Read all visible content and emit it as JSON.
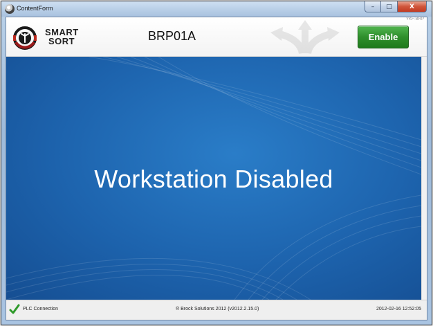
{
  "window": {
    "title": "ContentForm",
    "controls": {
      "minimize": "–",
      "maximize": "□",
      "close": "X"
    }
  },
  "header": {
    "corner_tag": "YKF-BRP",
    "logo_line1": "SMART",
    "logo_line2": "SORT",
    "station_name": "BRP01A",
    "enable_label": "Enable"
  },
  "main": {
    "message": "Workstation Disabled"
  },
  "status": {
    "plc_label": "PLC Connection",
    "plc_ok": true,
    "copyright": "® Brock Solutions 2012 (v2012.2.15.0)",
    "datetime": "2012-02-16 12:52:05"
  },
  "icons": {
    "app": "app-icon",
    "logo": "smartsort-logo-icon",
    "arrows": "direction-arrows-icon",
    "status": "check-icon"
  },
  "colors": {
    "enable_button": "#2f8f2c",
    "main_background": "#1d63ad",
    "status_check": "#2e9a2a"
  }
}
